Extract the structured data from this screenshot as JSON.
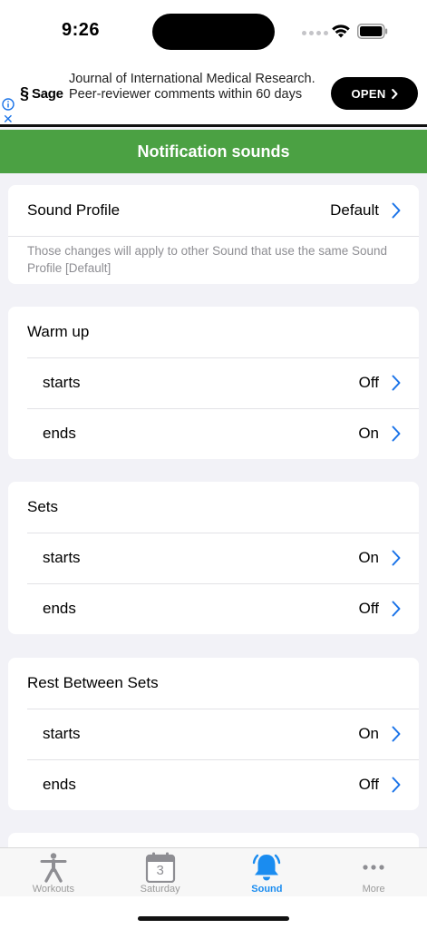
{
  "status_bar": {
    "time": "9:26"
  },
  "ad": {
    "brand": "Sage",
    "text": "Journal of International Medical Research. Peer-reviewer comments within 60 days",
    "cta": "OPEN",
    "close_glyph": "✕"
  },
  "header": {
    "title": "Notification sounds"
  },
  "profile_card": {
    "label": "Sound Profile",
    "value": "Default",
    "note": "Those changes will apply to other Sound that use the same Sound Profile [Default]"
  },
  "sections": [
    {
      "title": "Warm up",
      "starts_label": "starts",
      "starts_value": "Off",
      "ends_label": "ends",
      "ends_value": "On"
    },
    {
      "title": "Sets",
      "starts_label": "starts",
      "starts_value": "On",
      "ends_label": "ends",
      "ends_value": "Off"
    },
    {
      "title": "Rest Between Sets",
      "starts_label": "starts",
      "starts_value": "On",
      "ends_label": "ends",
      "ends_value": "Off"
    }
  ],
  "tabs": [
    {
      "label": "Workouts",
      "icon": "person-icon"
    },
    {
      "label": "Saturday",
      "icon": "calendar-icon",
      "badge": "3"
    },
    {
      "label": "Sound",
      "icon": "bell-icon",
      "active": true
    },
    {
      "label": "More",
      "icon": "ellipsis-icon"
    }
  ],
  "colors": {
    "header": "#4ba143",
    "accent": "#1a8cf0",
    "chevron": "#1a73e8"
  }
}
